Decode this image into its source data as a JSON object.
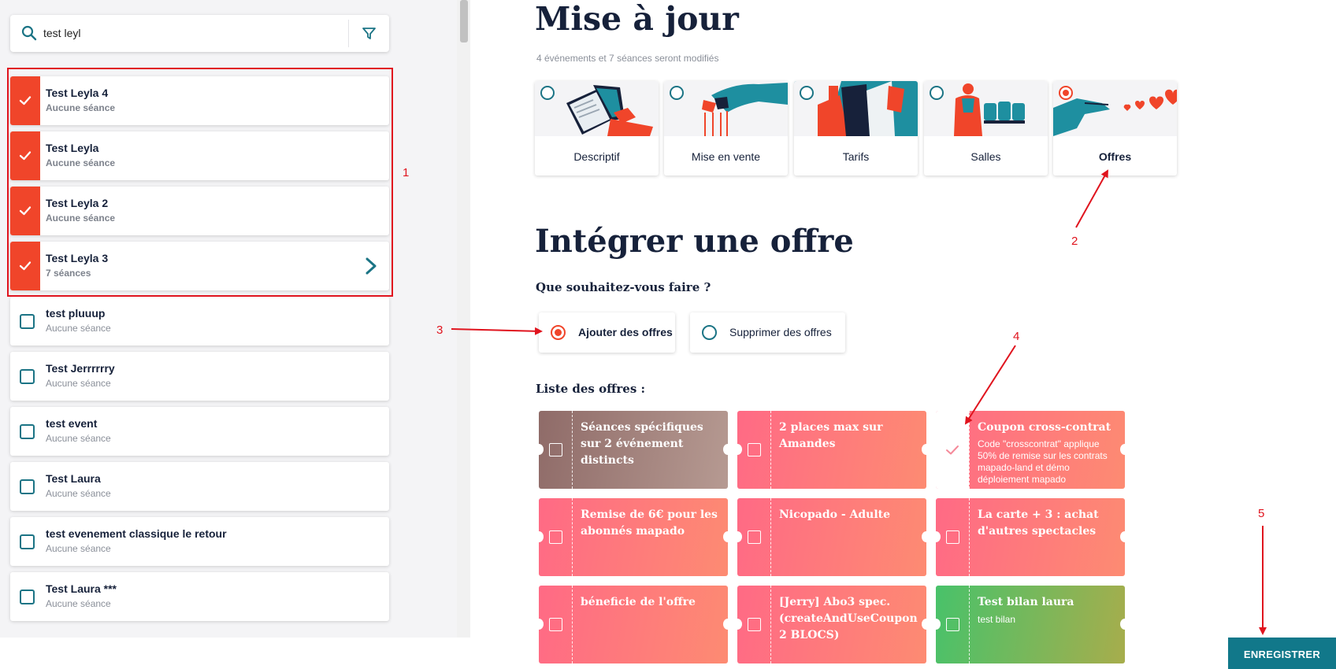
{
  "search": {
    "value": "test leyl"
  },
  "events": [
    {
      "title": "Test Leyla 4",
      "sub": "Aucune séance",
      "selected": true
    },
    {
      "title": "Test Leyla",
      "sub": "Aucune séance",
      "selected": true
    },
    {
      "title": "Test Leyla 2",
      "sub": "Aucune séance",
      "selected": true
    },
    {
      "title": "Test Leyla 3",
      "sub": "7 séances",
      "selected": true
    },
    {
      "title": "test pluuup",
      "sub": "Aucune séance",
      "selected": false
    },
    {
      "title": "Test Jerrrrrry",
      "sub": "Aucune séance",
      "selected": false
    },
    {
      "title": "test event",
      "sub": "Aucune séance",
      "selected": false
    },
    {
      "title": "Test Laura",
      "sub": "Aucune séance",
      "selected": false
    },
    {
      "title": "test evenement classique le retour",
      "sub": "Aucune séance",
      "selected": false
    },
    {
      "title": "Test Laura ***",
      "sub": "Aucune séance",
      "selected": false
    }
  ],
  "main": {
    "title": "Mise à jour",
    "subtitle": "4 événements et 7 séances seront modifiés",
    "sections": [
      {
        "label": "Descriptif",
        "selected": false
      },
      {
        "label": "Mise en vente",
        "selected": false
      },
      {
        "label": "Tarifs",
        "selected": false
      },
      {
        "label": "Salles",
        "selected": false
      },
      {
        "label": "Offres",
        "selected": true
      }
    ],
    "offer_title": "Intégrer une offre",
    "question": "Que souhaitez-vous faire ?",
    "choices": [
      {
        "label": "Ajouter des offres",
        "selected": true
      },
      {
        "label": "Supprimer des offres",
        "selected": false
      }
    ],
    "list_title": "Liste des offres :",
    "offers": [
      {
        "title": "Séances spécifiques sur 2 événement distincts",
        "desc": "",
        "checked": false,
        "colors": [
          "#8f6b68",
          "#b69a92"
        ]
      },
      {
        "title": "2 places max sur Amandes",
        "desc": "",
        "checked": false,
        "colors": [
          "#ff6a85",
          "#fd8b72"
        ]
      },
      {
        "title": "Coupon cross-contrat",
        "desc": "Code \"crosscontrat\" applique 50% de remise sur les contrats mapado-land et démo déploiement mapado",
        "checked": true,
        "colors": [
          "#ff6a85",
          "#fd8b72"
        ]
      },
      {
        "title": "Remise de 6€ pour les abonnés mapado",
        "desc": "",
        "checked": false,
        "colors": [
          "#ff6a85",
          "#fd8b72"
        ]
      },
      {
        "title": "Nicopado - Adulte",
        "desc": "",
        "checked": false,
        "colors": [
          "#ff6a85",
          "#fd8b72"
        ]
      },
      {
        "title": "La carte + 3 : achat d'autres spectacles",
        "desc": "",
        "checked": false,
        "colors": [
          "#ff6a85",
          "#fd8b72"
        ]
      },
      {
        "title": "béneficie de l'offre",
        "desc": "",
        "checked": false,
        "colors": [
          "#ff6a85",
          "#fd8b72"
        ]
      },
      {
        "title": "[Jerry] Abo3 spec. (createAndUseCoupon 2 BLOCS)",
        "desc": "",
        "checked": false,
        "colors": [
          "#ff6a85",
          "#fd8b72"
        ]
      },
      {
        "title": "Test bilan laura",
        "desc": "test bilan",
        "checked": false,
        "colors": [
          "#48c26a",
          "#a7ad4c"
        ]
      }
    ],
    "save_label": "ENREGISTRER"
  },
  "annotations": [
    "1",
    "2",
    "3",
    "4",
    "5"
  ],
  "colors": {
    "accent": "#f0452a",
    "teal": "#11788a",
    "navy": "#16213a",
    "annotation": "#e0141e"
  }
}
